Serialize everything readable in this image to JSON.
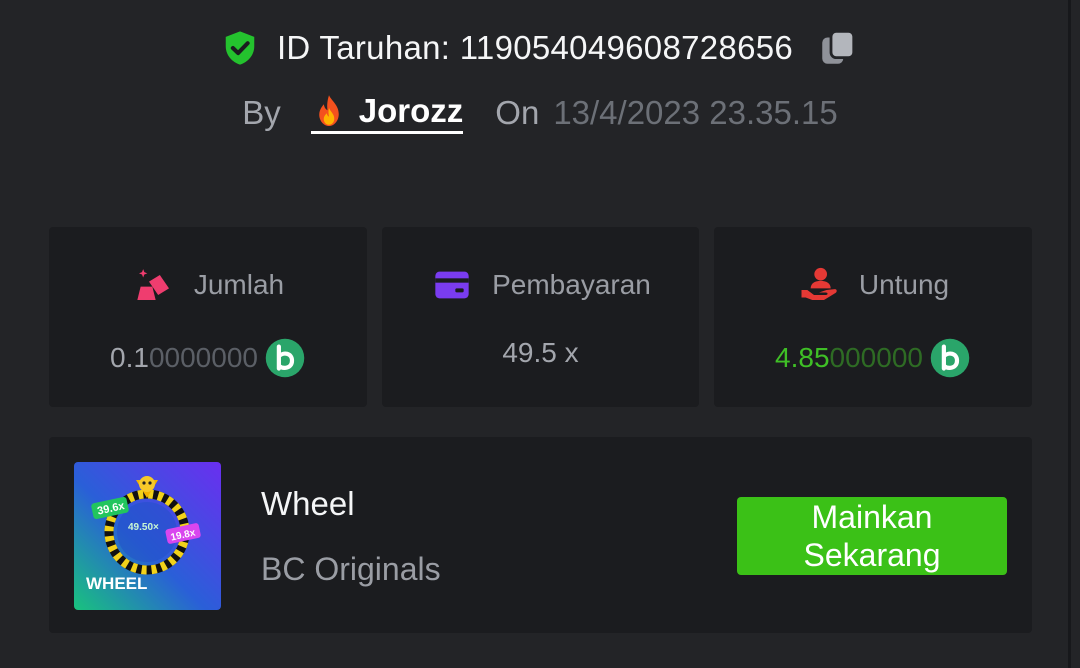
{
  "bet": {
    "id_text": "ID Taruhan: 119054049608728656",
    "by_label": "By",
    "username": "Jorozz",
    "on_label": "On",
    "datetime": "13/4/2023 23.35.15"
  },
  "stats": {
    "amount": {
      "label": "Jumlah",
      "value_main": "0.1",
      "value_dim": "0000000"
    },
    "payout": {
      "label": "Pembayaran",
      "value": "49.5 x"
    },
    "profit": {
      "label": "Untung",
      "value_main": "4.85",
      "value_dim": "000000"
    }
  },
  "game": {
    "name": "Wheel",
    "provider": "BC Originals",
    "play_label_line1": "Mainkan",
    "play_label_line2": "Sekarang",
    "thumbnail": {
      "title": "WHEEL",
      "multipliers": [
        "39.6x",
        "49.50×",
        "19.8x"
      ]
    }
  },
  "colors": {
    "background": "#232427",
    "card": "#1b1c1f",
    "accent_green": "#3bc117",
    "profit_green": "#3fbf26",
    "shield_green": "#24c22e",
    "jumlah_icon": "#ef3d6f",
    "pembayaran_icon": "#7a3cf0",
    "untung_icon": "#e53935",
    "coin": "#2aa56a"
  },
  "icons": {
    "shield": "shield-check-icon",
    "copy": "copy-icon",
    "fire": "fire-icon",
    "jumlah": "bet-amount-icon",
    "pembayaran": "wallet-card-icon",
    "untung": "profit-hand-icon",
    "coin": "bcd-coin-icon"
  }
}
